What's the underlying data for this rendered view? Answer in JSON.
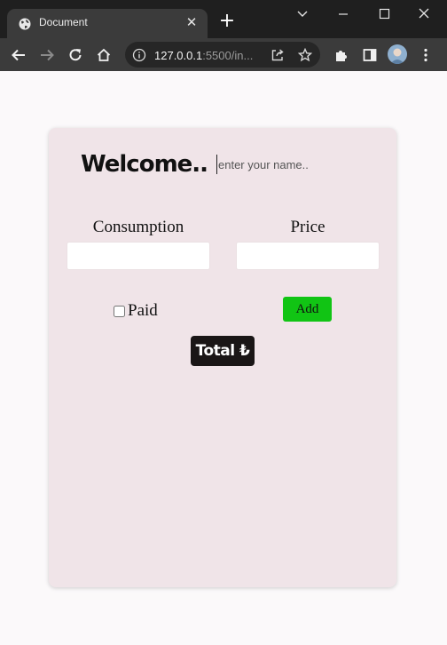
{
  "browser": {
    "tab_title": "Document",
    "tab_close": "✕",
    "new_tab": "+",
    "url_host": "127.0.0.1",
    "url_rest": ":5500/in..."
  },
  "page": {
    "heading": "Welcome..",
    "name_placeholder": "enter your name..",
    "consumption_label": "Consumption",
    "price_label": "Price",
    "paid_label": "Paid",
    "add_button": "Add",
    "total_button": "Total ₺"
  },
  "colors": {
    "card_bg": "#f0e4e8",
    "add_button": "#11c414",
    "total_button": "#1a1616"
  }
}
